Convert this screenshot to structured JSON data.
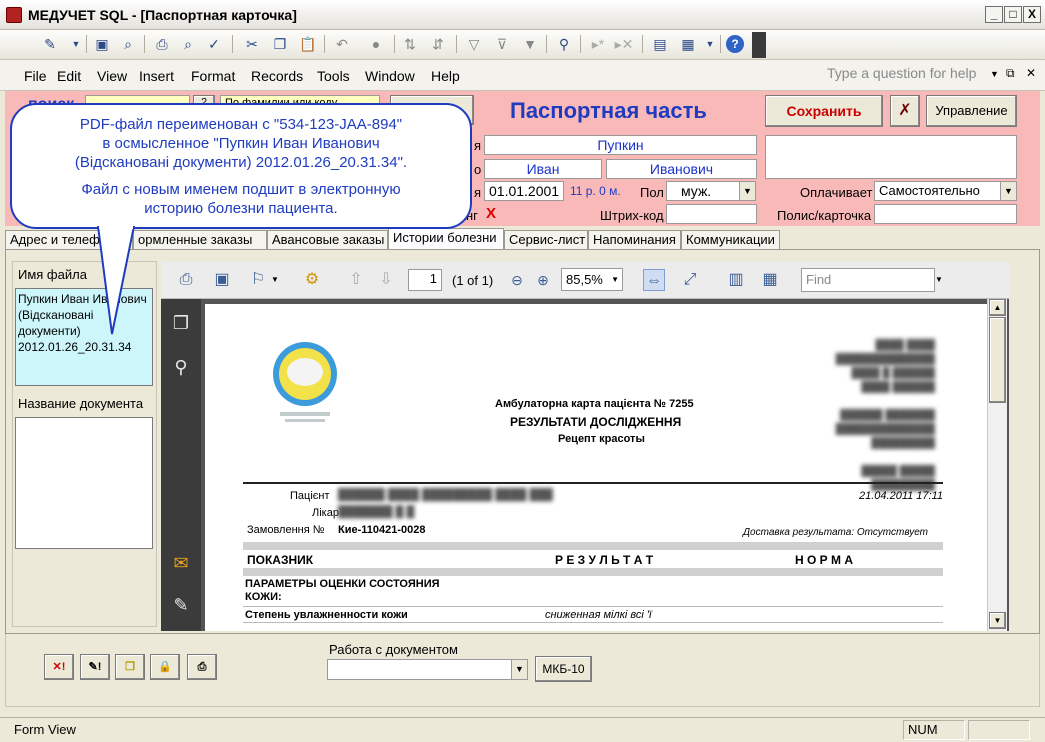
{
  "window": {
    "title": "МЕДУЧЕТ SQL - [Паспортная карточка]",
    "controls": {
      "minimize": "_",
      "restore": "□",
      "close": "X"
    }
  },
  "menu": {
    "items": [
      "File",
      "Edit",
      "View",
      "Insert",
      "Format",
      "Records",
      "Tools",
      "Window",
      "Help"
    ],
    "help_placeholder": "Type a question for help"
  },
  "header": {
    "search_label": "поиск",
    "search_hint": "По фамилии или коду",
    "passport_title": "Паспортная часть",
    "save_label": "Сохранить",
    "manage_label": "Управление",
    "surname": "Пупкин",
    "first_name": "Иван",
    "patronymic": "Иванович",
    "birth_date": "01.01.2001",
    "age": "11 р. 0 м.",
    "sex_label": "Пол",
    "sex_value": "муж.",
    "payer_label": "Оплачивает",
    "payer_value": "Самостоятельно",
    "barcode_label": "Штрих-код",
    "policy_label": "Полис/карточка",
    "x_mark": "X",
    "partial_labels": {
      "surname": "я",
      "name": "о",
      "birth": "я",
      "flag": "нг"
    }
  },
  "callout": {
    "line1": "PDF-файл переименован с \"534-123-JAA-894\"",
    "line2": "в осмысленное \"Пупкин Иван Иванович",
    "line3": "(Відскановані документи) 2012.01.26_20.31.34\".",
    "line4": "Файл с новым именем подшит в электронную",
    "line5": "историю болезни пациента."
  },
  "tabs": [
    {
      "label": "Адрес и телеф",
      "active": false
    },
    {
      "label": "ормленные заказы",
      "active": false
    },
    {
      "label": "Авансовые заказы",
      "active": false
    },
    {
      "label": "Истории болезни",
      "active": true
    },
    {
      "label": "Сервис-лист",
      "active": false
    },
    {
      "label": "Напоминания",
      "active": false
    },
    {
      "label": "Коммуникации",
      "active": false
    }
  ],
  "sidebar": {
    "filename_label": "Имя файла",
    "filename_value": "Пупкин Иван Иванович (Відскановані документи) 2012.01.26_20.31.34",
    "docname_label": "Название документа"
  },
  "viewer": {
    "page_input": "1",
    "page_count": "(1 of 1)",
    "zoom": "85,5%",
    "find_placeholder": "Find"
  },
  "document": {
    "card_title": "Амбулаторна карта пацієнта № 7255",
    "results_title": "РЕЗУЛЬТАТИ ДОСЛІДЖЕННЯ",
    "subtitle": "Рецепт красоты",
    "patient_label": "Пацієнт",
    "doctor_label": "Лікар",
    "order_label": "Замовлення №",
    "order_value": "Кие-110421-0028",
    "date": "21.04.2011 17:11",
    "delivery": "Доставка результата: Отсутствует",
    "col_indicator": "ПОКАЗНИК",
    "col_result": "Р Е З У Л Ь Т А Т",
    "col_norm": "Н О Р М А",
    "section": "ПАРАМЕТРЫ ОЦЕНКИ СОСТОЯНИЯ КОЖИ:",
    "row1_name": "Степень увлажненности кожи",
    "row1_value": "сниженная мілкі всі 'ї"
  },
  "bottom": {
    "work_label": "Работа с документом",
    "mkb_button": "МКБ-10"
  },
  "status": {
    "mode": "Form View",
    "num": "NUM"
  }
}
